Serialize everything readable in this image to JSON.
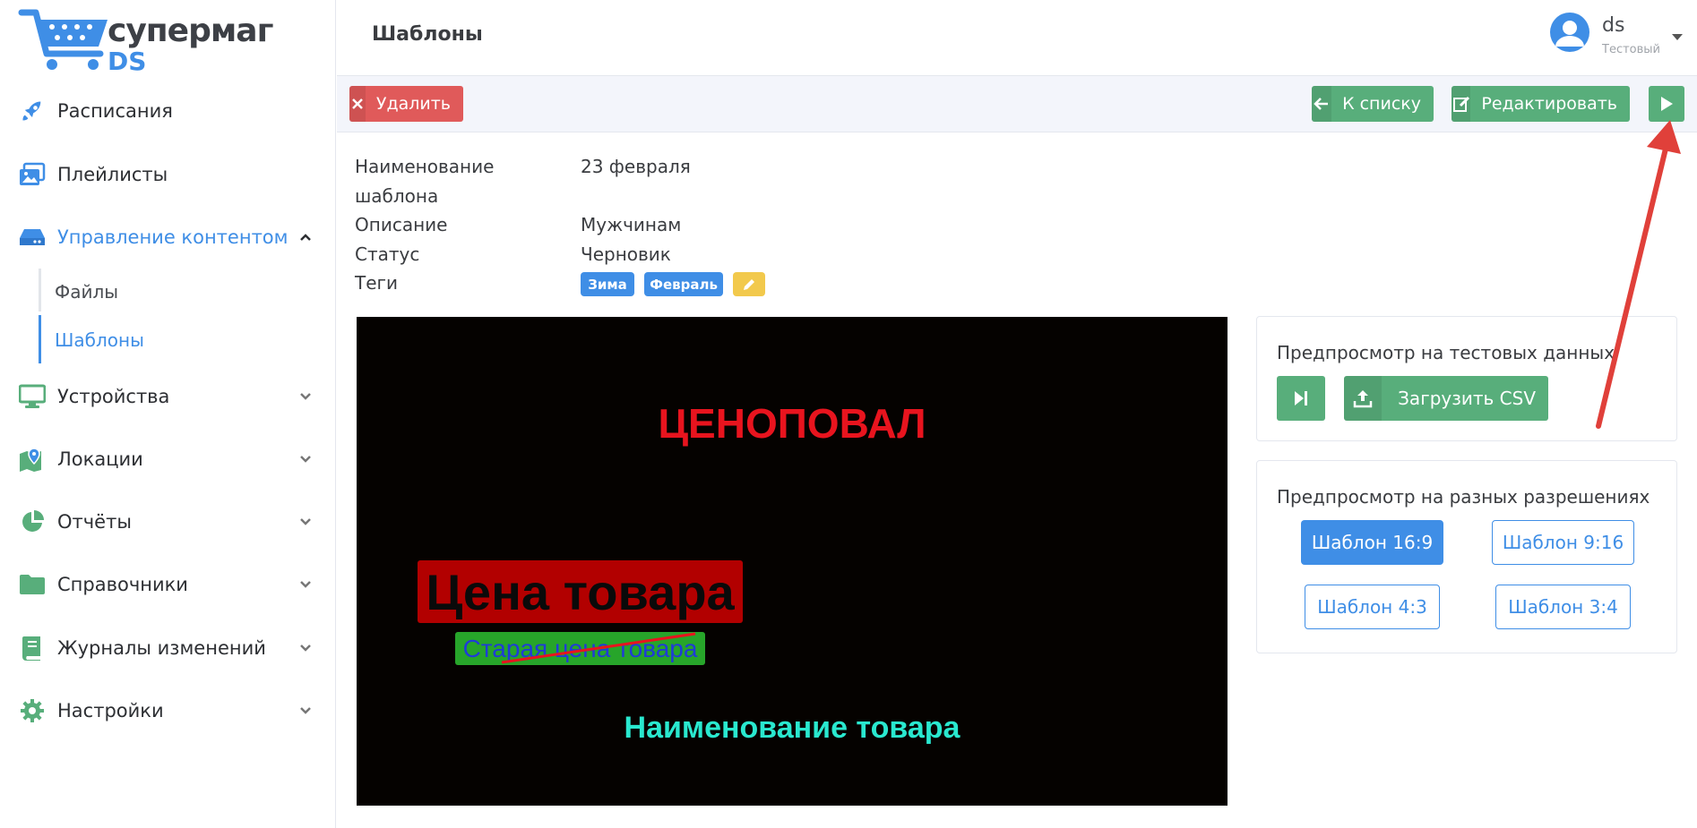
{
  "brand": {
    "line1": "супермаг",
    "line2": "DS"
  },
  "sidebar": {
    "items": [
      {
        "label": "Расписания",
        "icon": "rocket-icon"
      },
      {
        "label": "Плейлисты",
        "icon": "images-icon"
      },
      {
        "label": "Управление контентом",
        "icon": "hdd-icon"
      },
      {
        "label": "Устройства",
        "icon": "monitor-icon"
      },
      {
        "label": "Локации",
        "icon": "map-icon"
      },
      {
        "label": "Отчёты",
        "icon": "pie-chart-icon"
      },
      {
        "label": "Справочники",
        "icon": "folder-icon"
      },
      {
        "label": "Журналы изменений",
        "icon": "book-icon"
      },
      {
        "label": "Настройки",
        "icon": "gear-icon"
      }
    ],
    "subitems": [
      {
        "label": "Файлы"
      },
      {
        "label": "Шаблоны"
      }
    ]
  },
  "header": {
    "title": "Шаблоны",
    "user": {
      "name": "ds",
      "role": "Тестовый"
    }
  },
  "toolbar": {
    "delete_label": "Удалить",
    "back_label": "К списку",
    "edit_label": "Редактировать"
  },
  "details": {
    "name_label_1": "Наименование",
    "name_label_2": "шаблона",
    "name_value": "23 февраля",
    "desc_label": "Описание",
    "desc_value": "Мужчинам",
    "status_label": "Статус",
    "status_value": "Черновик",
    "tags_label": "Теги",
    "tags": [
      "Зима",
      "Февраль"
    ]
  },
  "preview": {
    "title": "ЦЕНОПОВАЛ",
    "price": "Цена товара",
    "old_price": "Старая цена товара",
    "product_name": "Наименование товара"
  },
  "panel_test": {
    "title": "Предпросмотр на тестовых данных",
    "upload_label": "Загрузить CSV"
  },
  "panel_res": {
    "title": "Предпросмотр на разных разрешениях",
    "buttons": [
      "Шаблон 16:9",
      "Шаблон 9:16",
      "Шаблон 4:3",
      "Шаблон 3:4"
    ]
  },
  "colors": {
    "accent": "#3f8ee6",
    "success": "#58ae7b",
    "danger": "#e05a5a",
    "warning": "#f2c94c",
    "annotation": "#e0403a"
  }
}
